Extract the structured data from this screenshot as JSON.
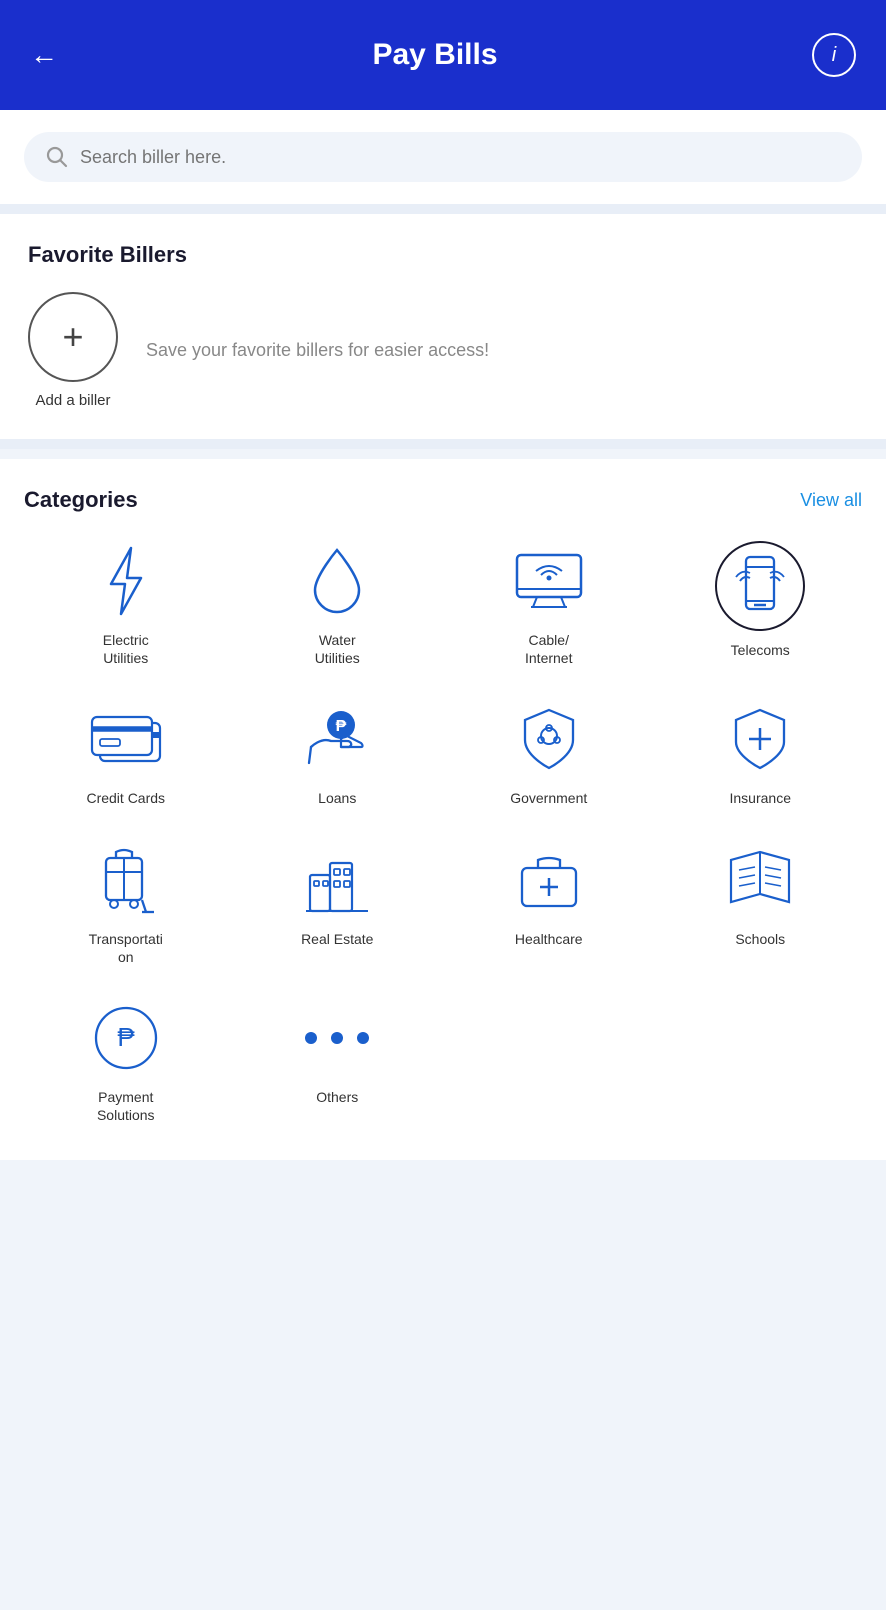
{
  "header": {
    "title": "Pay Bills",
    "back_label": "←",
    "info_label": "i"
  },
  "search": {
    "placeholder": "Search biller here."
  },
  "favorites": {
    "title": "Favorite Billers",
    "add_label": "Add a biller",
    "description": "Save your favorite billers for easier access!"
  },
  "categories": {
    "title": "Categories",
    "view_all_label": "View all",
    "items": [
      {
        "id": "electric-utilities",
        "label": "Electric\nUtilities",
        "highlighted": false
      },
      {
        "id": "water-utilities",
        "label": "Water\nUtilities",
        "highlighted": false
      },
      {
        "id": "cable-internet",
        "label": "Cable/\nInternet",
        "highlighted": false
      },
      {
        "id": "telecoms",
        "label": "Telecoms",
        "highlighted": true
      },
      {
        "id": "credit-cards",
        "label": "Credit Cards",
        "highlighted": false
      },
      {
        "id": "loans",
        "label": "Loans",
        "highlighted": false
      },
      {
        "id": "government",
        "label": "Government",
        "highlighted": false
      },
      {
        "id": "insurance",
        "label": "Insurance",
        "highlighted": false
      },
      {
        "id": "transportation",
        "label": "Transportati\non",
        "highlighted": false
      },
      {
        "id": "real-estate",
        "label": "Real Estate",
        "highlighted": false
      },
      {
        "id": "healthcare",
        "label": "Healthcare",
        "highlighted": false
      },
      {
        "id": "schools",
        "label": "Schools",
        "highlighted": false
      },
      {
        "id": "payment-solutions",
        "label": "Payment\nSolutions",
        "highlighted": false
      },
      {
        "id": "others",
        "label": "Others",
        "highlighted": false
      }
    ]
  }
}
